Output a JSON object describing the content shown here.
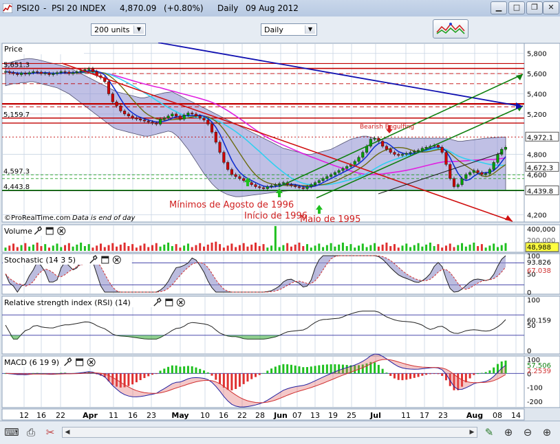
{
  "window": {
    "symbol": "PSI20",
    "separator": "-",
    "name": "PSI 20 INDEX",
    "price": "4,870.09",
    "change": "(+0.80%)",
    "period": "Daily",
    "date": "09 Aug 2012"
  },
  "toolbar": {
    "units_select": "200 units",
    "period_select": "Daily"
  },
  "colors": {
    "panel_bg": "#ffffff",
    "grid": "#c8d4e3",
    "candle_up": "#00a000",
    "candle_down": "#d00000",
    "bollinger_fill": "#8c8cd0",
    "ma_blue": "#1030d0",
    "ma_cyan": "#30d0f0",
    "ma_magenta": "#e020e0",
    "ma_olive": "#6b6b10",
    "stoch_fill": "#9090c8",
    "macd_pos": "#20c020",
    "macd_neg": "#e03030"
  },
  "chart_data": [
    {
      "type": "candlestick",
      "panel": "Price",
      "x_tick_labels": [
        "12",
        "16",
        "22",
        "Apr",
        "11",
        "16",
        "23",
        "May",
        "10",
        "16",
        "22",
        "28",
        "Jun",
        "07",
        "13",
        "19",
        "25",
        "Jul",
        "11",
        "17",
        "23",
        "Aug",
        "08",
        "14"
      ],
      "y_ticks": [
        5800,
        5600,
        5400,
        5200,
        4972.1,
        4800,
        4672.3,
        4600,
        4439.8,
        4200
      ],
      "y_tick_labels": [
        "5,800",
        "5,600",
        "5,400",
        "5,200",
        "4,972.1",
        "4,800",
        "4,672.3",
        "4,600",
        "4,439.8",
        "4,200"
      ],
      "level_labels": [
        "5,651.3",
        "5,159.7",
        "4,597.3",
        "4,443.8"
      ],
      "ylim": [
        4150,
        5880
      ],
      "close": [
        5620,
        5610,
        5600,
        5590,
        5605,
        5595,
        5610,
        5620,
        5615,
        5600,
        5605,
        5590,
        5600,
        5610,
        5620,
        5615,
        5600,
        5610,
        5620,
        5630,
        5640,
        5650,
        5620,
        5580,
        5560,
        5520,
        5400,
        5320,
        5280,
        5230,
        5200,
        5180,
        5160,
        5150,
        5140,
        5130,
        5120,
        5110,
        5100,
        5150,
        5160,
        5180,
        5200,
        5180,
        5150,
        5190,
        5210,
        5200,
        5180,
        5160,
        5140,
        5100,
        5020,
        4920,
        4820,
        4720,
        4650,
        4600,
        4580,
        4560,
        4540,
        4520,
        4500,
        4480,
        4470,
        4460,
        4480,
        4490,
        4500,
        4510,
        4520,
        4500,
        4490,
        4480,
        4470,
        4460,
        4480,
        4500,
        4520,
        4540,
        4560,
        4580,
        4600,
        4620,
        4640,
        4660,
        4680,
        4700,
        4730,
        4770,
        4820,
        4880,
        4950,
        4960,
        4930,
        4880,
        4850,
        4820,
        4800,
        4790,
        4800,
        4810,
        4820,
        4830,
        4840,
        4860,
        4870,
        4880,
        4890,
        4870,
        4820,
        4700,
        4560,
        4480,
        4500,
        4560,
        4600,
        4620,
        4640,
        4620,
        4600,
        4610,
        4650,
        4720,
        4800,
        4850,
        4870
      ],
      "bollinger_upper": [
        5700,
        5710,
        5720,
        5730,
        5740,
        5745,
        5750,
        5745,
        5740,
        5730,
        5720,
        5710,
        5700,
        5690,
        5680,
        5670,
        5660,
        5640,
        5620,
        5600,
        5580,
        5560,
        5540,
        5520,
        5500,
        5480,
        5460,
        5440,
        5420,
        5410,
        5400,
        5390,
        5380,
        5370,
        5360,
        5360,
        5370,
        5380,
        5390,
        5400,
        5410,
        5415,
        5420,
        5400,
        5380,
        5360,
        5340,
        5320,
        5300,
        5280,
        5260,
        5240,
        5220,
        5200,
        5180,
        5160,
        5140,
        5120,
        5100,
        5080,
        5060,
        5040,
        5020,
        5000,
        4980,
        4960,
        4940,
        4920,
        4900,
        4880,
        4860,
        4850,
        4840,
        4830,
        4820,
        4810,
        4800,
        4800,
        4810,
        4820,
        4830,
        4840,
        4850,
        4870,
        4890,
        4910,
        4930,
        4950,
        4960,
        4970,
        4980,
        4980,
        4970,
        4960,
        4950,
        4950,
        4960,
        4960,
        4960,
        4960,
        4960,
        4960,
        4960,
        4960,
        4960,
        4960,
        4960,
        4960,
        4960,
        4960,
        4960,
        4960,
        4950,
        4940,
        4930,
        4930,
        4935,
        4940,
        4945,
        4950,
        4955,
        4960,
        4962,
        4965,
        4968,
        4970,
        4972
      ],
      "bollinger_lower": [
        5480,
        5490,
        5500,
        5500,
        5510,
        5510,
        5520,
        5520,
        5510,
        5500,
        5490,
        5480,
        5470,
        5460,
        5440,
        5420,
        5400,
        5370,
        5340,
        5310,
        5280,
        5250,
        5220,
        5190,
        5160,
        5130,
        5100,
        5070,
        5050,
        5040,
        5030,
        5020,
        5010,
        5000,
        4990,
        4980,
        4980,
        4990,
        5000,
        5010,
        5020,
        5030,
        5020,
        4990,
        4950,
        4900,
        4850,
        4790,
        4730,
        4670,
        4610,
        4560,
        4510,
        4470,
        4440,
        4420,
        4400,
        4390,
        4380,
        4380,
        4385,
        4390,
        4395,
        4400,
        4405,
        4410,
        4415,
        4420,
        4425,
        4430,
        4435,
        4438,
        4440,
        4440,
        4440,
        4440,
        4440,
        4440,
        4440,
        4440,
        4440,
        4440,
        4440,
        4440,
        4440,
        4440,
        4440,
        4440,
        4440,
        4440,
        4440,
        4440,
        4440,
        4440,
        4440,
        4440,
        4440,
        4440,
        4440,
        4440,
        4440,
        4440,
        4440,
        4440,
        4440,
        4440,
        4440,
        4440,
        4440,
        4440,
        4440,
        4440,
        4440,
        4440,
        4440,
        4440,
        4440,
        4440,
        4440,
        4440,
        4440,
        4440,
        4440,
        4440,
        4440,
        4440,
        4440
      ]
    },
    {
      "type": "bar",
      "panel": "Volume",
      "label": "Volume",
      "y_tick_labels": [
        "400,000",
        "200,000",
        "48,988"
      ],
      "last_value": "48,988"
    },
    {
      "type": "line",
      "panel": "Stochastic",
      "label": "Stochastic (14 3 5)",
      "y_tick_labels": [
        "100",
        "50",
        "0"
      ],
      "values_labels": [
        "93.826",
        "67.038"
      ]
    },
    {
      "type": "line",
      "panel": "RSI",
      "label": "Relative strength index (RSI) (14)",
      "y_tick_labels": [
        "100",
        "50",
        "0"
      ],
      "value_label": "60.159"
    },
    {
      "type": "bar",
      "panel": "MACD",
      "label": "MACD (6 19 9)",
      "y_tick_labels": [
        "100",
        "0",
        "-100",
        "-200"
      ],
      "values_labels": [
        "57.506",
        "2.2539"
      ]
    }
  ],
  "annotations": {
    "bearish": "Bearish Engulfing",
    "agosto": "Mínimos de Agosto de 1996",
    "inicio": "Início de 1996",
    "maio": "Maio de 1995",
    "copyright": "©ProRealTime.com",
    "note": "Data is end of day"
  }
}
